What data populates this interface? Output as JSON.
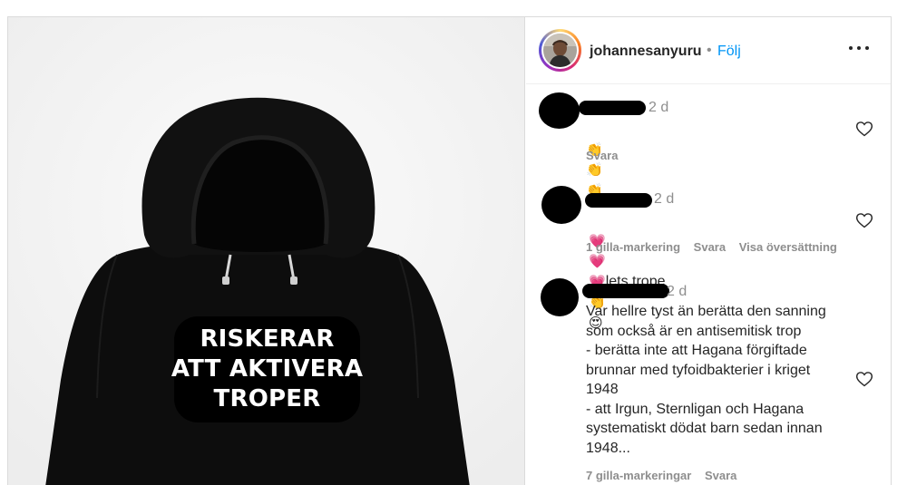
{
  "post": {
    "image": {
      "overlay_lines": [
        "RISKERAR",
        "ATT AKTIVERA",
        "TROPER"
      ],
      "colors": {
        "hoodie": "#0d0d0d",
        "overlay_bg": "#000000",
        "overlay_text": "#ffffff"
      }
    },
    "header": {
      "username": "johannesanyuru",
      "separator": "•",
      "follow_label": "Följ",
      "more_icon": "more-horizontal-icon"
    },
    "comments": [
      {
        "time": "2 d",
        "text": "",
        "emojis": [
          "👏",
          "👏",
          "👏"
        ],
        "meta": [
          "Svara"
        ]
      },
      {
        "time": "2 d",
        "text": "lets trope",
        "emojis_before": [
          "💗",
          "💗",
          "💗"
        ],
        "emojis_after": [
          "👏",
          "😍"
        ],
        "meta": [
          "1 gilla-markering",
          "Svara",
          "Visa översättning"
        ]
      },
      {
        "time": "2 d",
        "text": "Var hellre tyst än berätta den sanning\nsom också är en antisemitisk trop\n- berätta inte att Hagana förgiftade\nbrunnar med tyfoidbakterier i kriget\n1948\n- att Irgun, Sternligan och Hagana\nsystematiskt dödat barn sedan innan\n1948...",
        "meta": [
          "7 gilla-markeringar",
          "Svara"
        ]
      }
    ],
    "colors": {
      "link": "#0095f6",
      "secondary": "#8e8e8e",
      "primary": "#262626",
      "border": "#dbdbdb"
    }
  }
}
